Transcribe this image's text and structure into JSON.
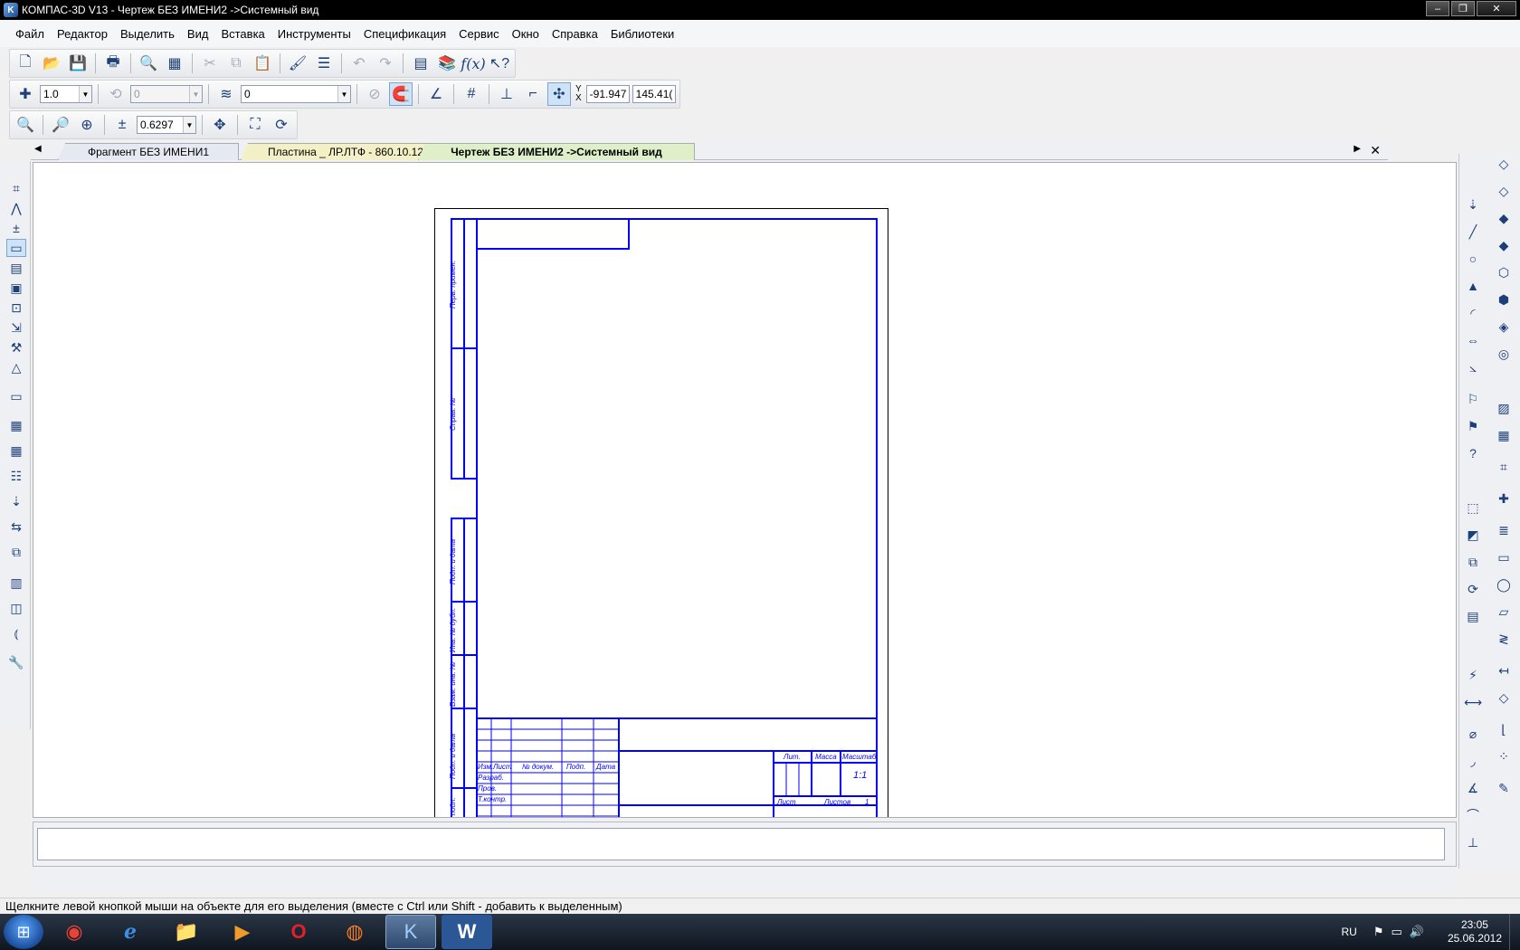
{
  "window": {
    "title": "КОМПАС-3D V13 - Чертеж БЕЗ ИМЕНИ2 ->Системный вид",
    "controls": [
      "minimize",
      "restore",
      "close"
    ]
  },
  "menu": [
    "Файл",
    "Редактор",
    "Выделить",
    "Вид",
    "Вставка",
    "Инструменты",
    "Спецификация",
    "Сервис",
    "Окно",
    "Справка",
    "Библиотеки"
  ],
  "toolbar_current": {
    "step": "1.0",
    "angle": "0",
    "layer": "0",
    "coord_y_label": "Y",
    "coord_x_label": "X",
    "x_value": "-91.947",
    "y_value": "145.41("
  },
  "toolbar_view": {
    "zoom": "0.6297"
  },
  "tabs": [
    {
      "label": "Фрагмент БЕЗ ИМЕНИ1",
      "color": "#e5eaf2"
    },
    {
      "label": "Пластина _ ЛР.ЛТФ - 860.10.12",
      "color": "#f4f0c5"
    },
    {
      "label": "Чертеж БЕЗ ИМЕНИ2 ->Системный вид",
      "color": "#dff0c8",
      "active": true
    }
  ],
  "drawing": {
    "frame_color": "#0000ff",
    "side_labels": [
      "Перв. примен.",
      "Справ. №",
      "Подп. и дата",
      "Инв. № дубл.",
      "Взам. инв. №",
      "Подп. и дата",
      "Инв. № подл."
    ],
    "title_block_headers": [
      "Изм.",
      "Лист",
      "№ докум.",
      "Подп.",
      "Дата"
    ],
    "title_block_rows": [
      "Разраб.",
      "Пров.",
      "Т.контр."
    ],
    "title_block_right": [
      "Лит.",
      "Масса",
      "Масштаб",
      "Лист",
      "Листов",
      "1"
    ],
    "scale_value": "1:1"
  },
  "status_text": "Щелкните левой кнопкой мыши на объекте для его выделения (вместе с Ctrl или Shift - добавить к выделенным)",
  "taskbar": {
    "apps": [
      "chrome",
      "internet-explorer",
      "explorer",
      "media-player",
      "opera",
      "firefox",
      "kompas",
      "word"
    ],
    "active_app": "kompas",
    "language": "RU",
    "time": "23:05",
    "date": "25.06.2012"
  }
}
